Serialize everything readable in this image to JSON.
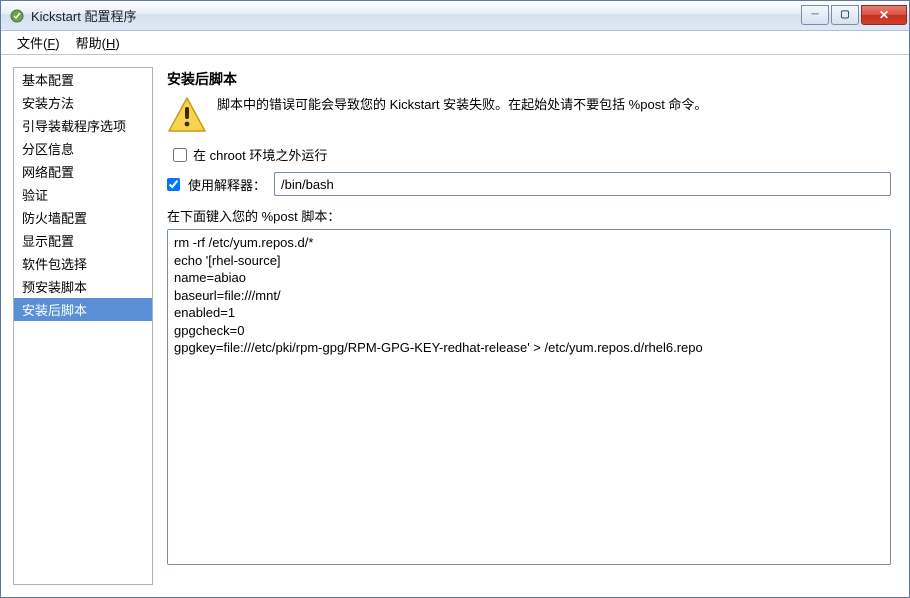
{
  "window": {
    "title": "Kickstart 配置程序"
  },
  "menubar": {
    "file": {
      "label": "文件(",
      "key": "F",
      "tail": ")"
    },
    "help": {
      "label": "帮助(",
      "key": "H",
      "tail": ")"
    }
  },
  "sidebar": {
    "items": [
      "基本配置",
      "安装方法",
      "引导装载程序选项",
      "分区信息",
      "网络配置",
      "验证",
      "防火墙配置",
      "显示配置",
      "软件包选择",
      "预安装脚本",
      "安装后脚本"
    ]
  },
  "main": {
    "title": "安装后脚本",
    "warning": "脚本中的错误可能会导致您的  Kickstart  安装失败。在起始处请不要包括  %post 命令。",
    "chroot_label": "在  chroot 环境之外运行",
    "chroot_checked": false,
    "interp_label": "使用解释器：",
    "interp_checked": true,
    "interp_value": "/bin/bash",
    "script_label": "在下面键入您的 %post 脚本：",
    "script": "rm -rf /etc/yum.repos.d/*\necho '[rhel-source]\nname=abiao\nbaseurl=file:///mnt/\nenabled=1\ngpgcheck=0\ngpgkey=file:///etc/pki/rpm-gpg/RPM-GPG-KEY-redhat-release' > /etc/yum.repos.d/rhel6.repo"
  }
}
